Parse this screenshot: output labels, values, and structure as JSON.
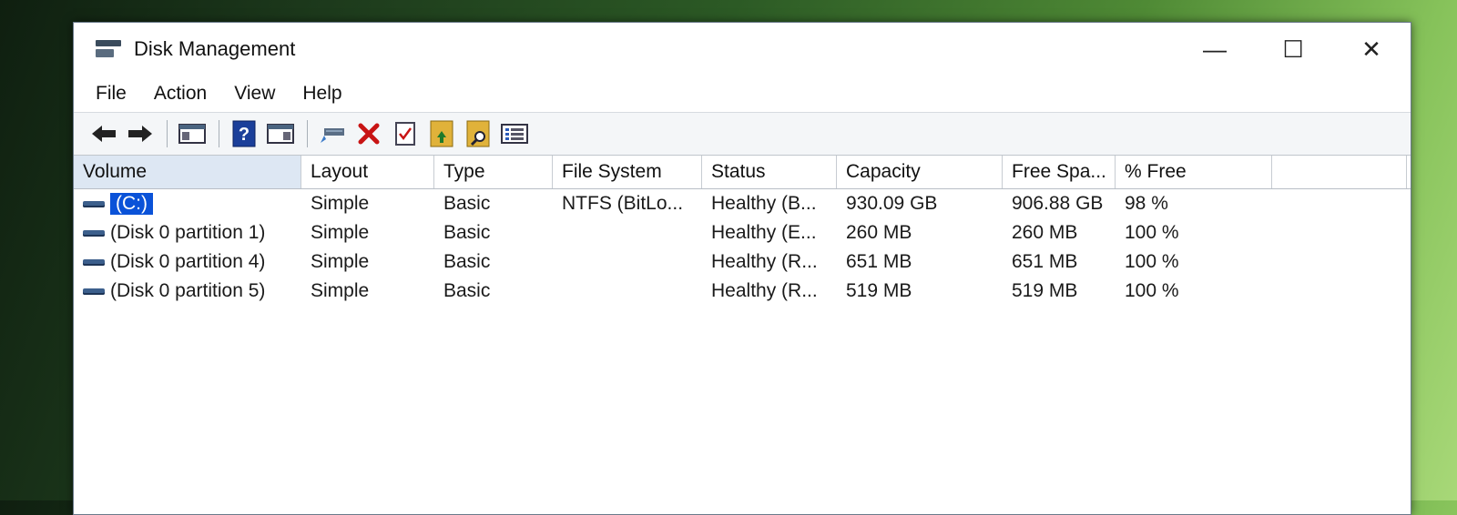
{
  "window": {
    "title": "Disk Management",
    "controls": {
      "minimize": "—",
      "maximize": "☐",
      "close": "✕"
    }
  },
  "menu": [
    "File",
    "Action",
    "View",
    "Help"
  ],
  "toolbar": [
    {
      "name": "back-icon"
    },
    {
      "name": "forward-icon"
    },
    {
      "name": "console-tree-icon"
    },
    {
      "name": "help-icon"
    },
    {
      "name": "action-pane-icon"
    },
    {
      "name": "connect-icon"
    },
    {
      "name": "delete-icon"
    },
    {
      "name": "properties-icon"
    },
    {
      "name": "folder-up-icon"
    },
    {
      "name": "folder-search-icon"
    },
    {
      "name": "list-view-icon"
    }
  ],
  "table": {
    "columns": [
      "Volume",
      "Layout",
      "Type",
      "File System",
      "Status",
      "Capacity",
      "Free Spa...",
      "% Free"
    ],
    "rows": [
      {
        "volume": "(C:)",
        "layout": "Simple",
        "type": "Basic",
        "fs": "NTFS (BitLo...",
        "status": "Healthy (B...",
        "capacity": "930.09 GB",
        "free": "906.88 GB",
        "pct": "98 %"
      },
      {
        "volume": "(Disk 0 partition 1)",
        "layout": "Simple",
        "type": "Basic",
        "fs": "",
        "status": "Healthy (E...",
        "capacity": "260 MB",
        "free": "260 MB",
        "pct": "100 %"
      },
      {
        "volume": "(Disk 0 partition 4)",
        "layout": "Simple",
        "type": "Basic",
        "fs": "",
        "status": "Healthy (R...",
        "capacity": "651 MB",
        "free": "651 MB",
        "pct": "100 %"
      },
      {
        "volume": "(Disk 0 partition 5)",
        "layout": "Simple",
        "type": "Basic",
        "fs": "",
        "status": "Healthy (R...",
        "capacity": "519 MB",
        "free": "519 MB",
        "pct": "100 %"
      }
    ]
  },
  "colors": {
    "selection": "#0a52d8",
    "accent": "#3c5f8c"
  }
}
